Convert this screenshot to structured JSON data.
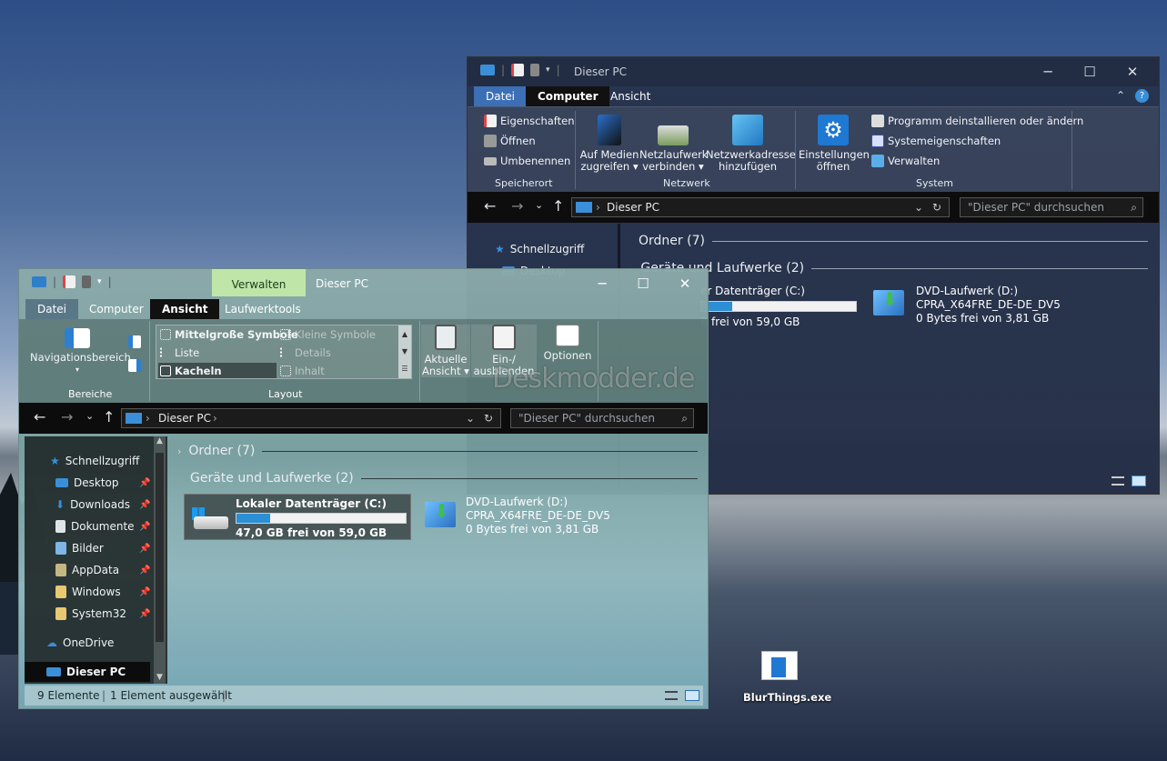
{
  "back_window": {
    "title": "Dieser PC",
    "tabs": [
      "Datei",
      "Computer",
      "Ansicht"
    ],
    "active_tab": "Computer",
    "ribbon": {
      "speicherort": {
        "items": [
          "Eigenschaften",
          "Öffnen",
          "Umbenennen"
        ],
        "label": "Speicherort"
      },
      "netzwerk": {
        "medien": [
          "Auf Medien",
          "zugreifen"
        ],
        "netzlaufwerk": [
          "Netzlaufwerk",
          "verbinden"
        ],
        "netzwerkadresse": [
          "Netzwerkadresse",
          "hinzufügen"
        ],
        "label": "Netzwerk"
      },
      "system": {
        "einstellungen": [
          "Einstellungen",
          "öffnen"
        ],
        "items": [
          "Programm deinstallieren oder ändern",
          "Systemeigenschaften",
          "Verwalten"
        ],
        "label": "System"
      }
    },
    "address": "Dieser PC",
    "search_placeholder": "\"Dieser PC\" durchsuchen",
    "nav": [
      "Schnellzugriff",
      "Desktop"
    ],
    "ordner": "Ordner (7)",
    "geraete": "Geräte und Laufwerke (2)",
    "drive_c": {
      "name": "er Datenträger (C:)",
      "free": "B frei von 59,0 GB",
      "fill": 0.2
    },
    "drive_d": {
      "name": "DVD-Laufwerk (D:)",
      "label": "CPRA_X64FRE_DE-DE_DV5",
      "free": "0 Bytes frei von 3,81 GB"
    }
  },
  "front_window": {
    "title": "Dieser PC",
    "manage_tab": "Verwalten",
    "tabs": [
      "Datei",
      "Computer",
      "Ansicht",
      "Laufwerktools"
    ],
    "active_tab": "Ansicht",
    "ribbon": {
      "nav_pane": "Navigationsbereich",
      "bereiche": "Bereiche",
      "layout_items": [
        "Mittelgroße Symbole",
        "Kleine Symbole",
        "Liste",
        "Details",
        "Kacheln",
        "Inhalt"
      ],
      "layout_label": "Layout",
      "aktuelle_ansicht": [
        "Aktuelle",
        "Ansicht"
      ],
      "ein_aus": [
        "Ein-/",
        "ausblenden"
      ],
      "optionen": "Optionen"
    },
    "address": "Dieser PC",
    "search_placeholder": "\"Dieser PC\" durchsuchen",
    "nav": [
      "Schnellzugriff",
      "Desktop",
      "Downloads",
      "Dokumente",
      "Bilder",
      "AppData",
      "Windows",
      "System32",
      "OneDrive",
      "Dieser PC"
    ],
    "ordner": "Ordner (7)",
    "geraete": "Geräte und Laufwerke (2)",
    "drive_c": {
      "name": "Lokaler Datenträger (C:)",
      "free": "47,0 GB frei von 59,0 GB",
      "fill": 0.2
    },
    "drive_d": {
      "name": "DVD-Laufwerk (D:)",
      "label": "CPRA_X64FRE_DE-DE_DV5",
      "free": "0 Bytes frei von 3,81 GB"
    },
    "status": {
      "count": "9 Elemente",
      "selected": "1 Element ausgewählt"
    }
  },
  "watermark": "Deskmodder.de",
  "desktop_icon": "BlurThings.exe",
  "colors": {
    "accent": "#2b8fd6",
    "manage_tab": "#bfe6a8",
    "folder": "#e8c870"
  }
}
